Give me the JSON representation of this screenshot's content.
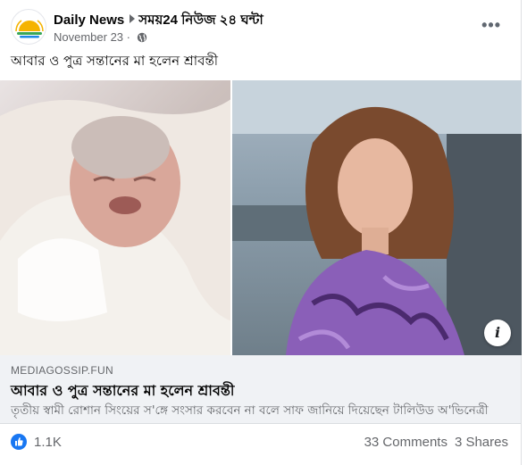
{
  "post": {
    "page_name": "Daily News",
    "group_name": "সময়24 নিউজ ২৪ ঘন্টা",
    "date": "November 23",
    "separator": " · ",
    "text": "আবার ও পুত্র সন্তানের মা হলেন শ্রাবন্তী",
    "privacy_icon": "globe-icon",
    "more_icon": "more-options-icon"
  },
  "link_preview": {
    "domain": "MEDIAGOSSIP.FUN",
    "title": "আবার ও পুত্র সন্তানের মা হলেন শ্রাবন্তী",
    "description": "তৃতীয় স্বামী রোশান সিংয়ের স'ঙ্গে সংসার করবেন না বলে সাফ জানিয়ে দিয়েছেন টালিউড অ'ভিনেত্রী",
    "info_icon": "i"
  },
  "footer": {
    "reaction_count": "1.1K",
    "comments": "33 Comments",
    "shares": "3 Shares"
  },
  "colors": {
    "facebook_blue": "#1877f2",
    "secondary_text": "#65676b",
    "link_box_bg": "#f0f2f5"
  }
}
